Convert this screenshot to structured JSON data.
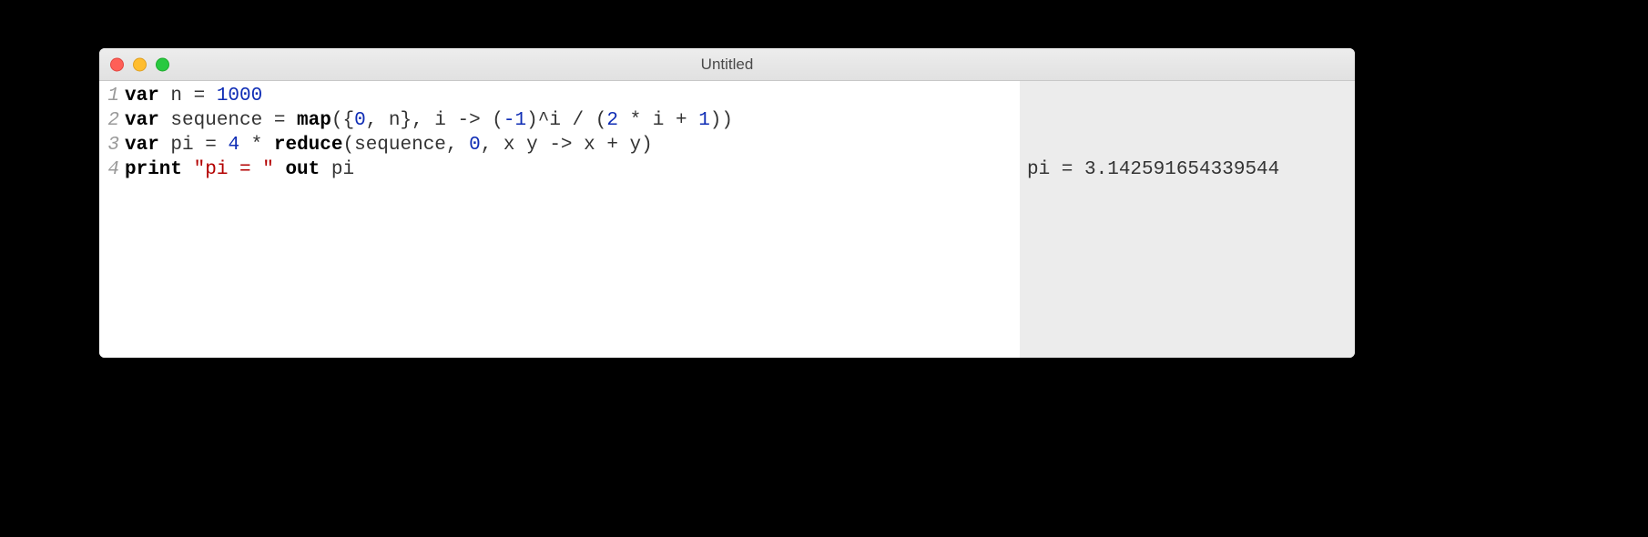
{
  "window": {
    "title": "Untitled"
  },
  "editor": {
    "lines": [
      {
        "n": "1"
      },
      {
        "n": "2"
      },
      {
        "n": "3"
      },
      {
        "n": "4"
      }
    ],
    "code": {
      "l1": {
        "kw1": "var",
        "rest1": " n = ",
        "num1": "1000"
      },
      "l2": {
        "kw1": "var",
        "rest1": " sequence = ",
        "kw2": "map",
        "rest2": "({",
        "num1": "0",
        "rest3": ", n}, i -> (",
        "num2": "-1",
        "rest4": ")^i / (",
        "num3": "2",
        "rest5": " * i + ",
        "num4": "1",
        "rest6": "))"
      },
      "l3": {
        "kw1": "var",
        "rest1": " pi = ",
        "num1": "4",
        "rest2": " * ",
        "kw2": "reduce",
        "rest3": "(sequence, ",
        "num2": "0",
        "rest4": ", x y -> x + y)"
      },
      "l4": {
        "kw1": "print",
        "rest1": " ",
        "str1": "\"pi = \"",
        "rest2": " ",
        "kw2": "out",
        "rest3": " pi"
      }
    }
  },
  "output": {
    "lines": [
      "",
      "",
      "",
      "pi = 3.142591654339544"
    ]
  }
}
